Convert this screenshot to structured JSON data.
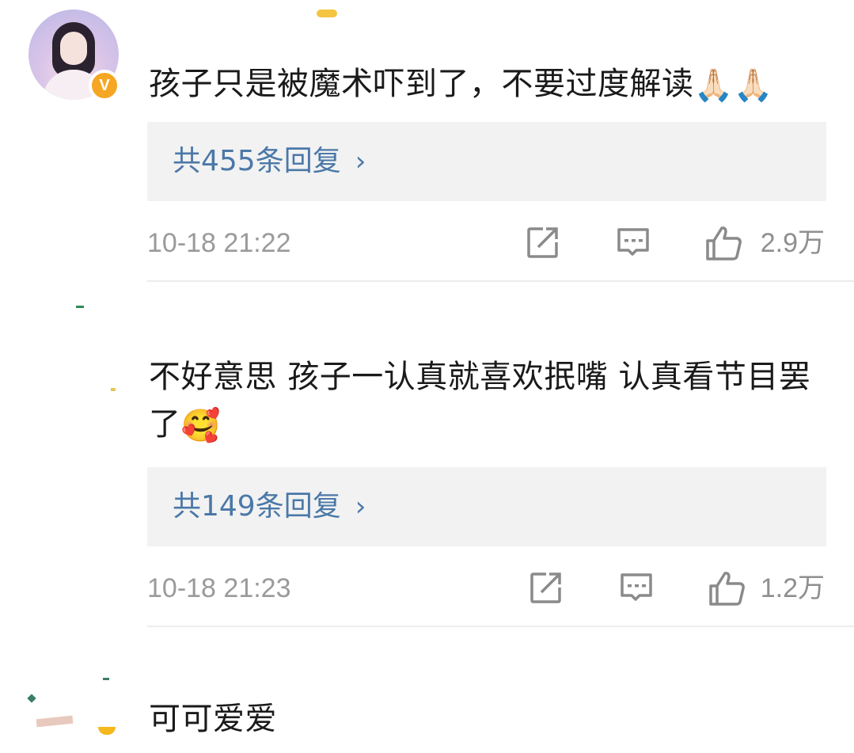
{
  "comments": [
    {
      "text": "孩子只是被魔术吓到了，不要过度解读",
      "emoji": "🙏🏻🙏🏻",
      "replies_label": "共455条回复",
      "timestamp": "10-18 21:22",
      "likes": "2.9万",
      "verified_badge": "V"
    },
    {
      "text": "不好意思 孩子一认真就喜欢抿嘴 认真看节目罢了",
      "emoji": "🥰",
      "replies_label": "共149条回复",
      "timestamp": "10-18 21:23",
      "likes": "1.2万"
    },
    {
      "text": "可可爱爱"
    }
  ],
  "icons": {
    "share": "share-icon",
    "comment": "comment-icon",
    "like": "thumbs-up-icon",
    "replies_chevron": "chevron-right-icon"
  },
  "colors": {
    "link": "#4b78a8",
    "reply_bg": "#f2f2f2",
    "meta": "#9a9a9a",
    "badge": "#f5a623"
  }
}
